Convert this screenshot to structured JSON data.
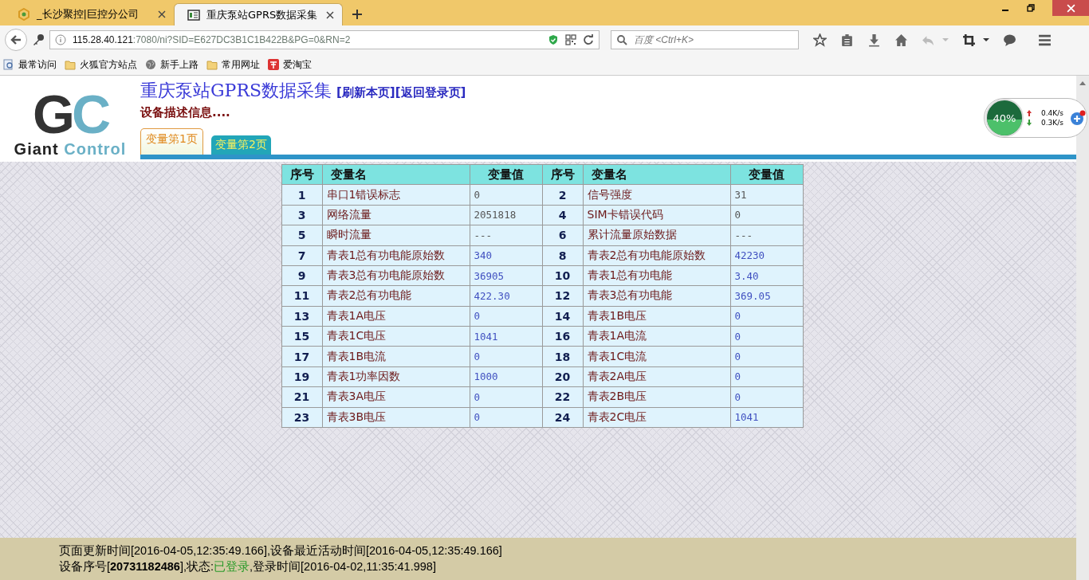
{
  "browser": {
    "tabs": [
      {
        "title": "_长沙聚控|巨控分公司",
        "selected": false
      },
      {
        "title": "重庆泵站GPRS数据采集",
        "selected": true
      }
    ],
    "address": {
      "host": "115.28.40.121",
      "rest": ":7080/ni?SID=E627DC3B1C1B422B&PG=0&RN=2"
    },
    "search": {
      "placeholder": "百度 <Ctrl+K>"
    },
    "bookmarks": [
      {
        "label": "最常访问",
        "kind": "search"
      },
      {
        "label": "火狐官方站点",
        "kind": "folder"
      },
      {
        "label": "新手上路",
        "kind": "globe"
      },
      {
        "label": "常用网址",
        "kind": "folder"
      },
      {
        "label": "爱淘宝",
        "kind": "shop"
      }
    ]
  },
  "logo": {
    "mark_left": "G",
    "mark_right": "C",
    "word1": "Giant",
    "word2": "Control"
  },
  "header": {
    "title": "重庆泵站GPRS数据采集",
    "links": [
      "[刷新本页]",
      "[返回登录页]"
    ],
    "subtitle": "设备描述信息...."
  },
  "page_tabs": [
    {
      "label": "变量第1页",
      "selected": true
    },
    {
      "label": "变量第2页",
      "selected": false
    }
  ],
  "table": {
    "columns": [
      "序号",
      "变量名",
      "变量值",
      "序号",
      "变量名",
      "变量值"
    ],
    "rows": [
      [
        {
          "no": "1",
          "name": "串口1错误标志",
          "value": "0",
          "kind": "raw"
        },
        {
          "no": "2",
          "name": "信号强度",
          "value": "31",
          "kind": "raw"
        }
      ],
      [
        {
          "no": "3",
          "name": "网络流量",
          "value": "2051818",
          "kind": "raw"
        },
        {
          "no": "4",
          "name": "SIM卡错误代码",
          "value": "0",
          "kind": "raw"
        }
      ],
      [
        {
          "no": "5",
          "name": "瞬时流量",
          "value": "---",
          "kind": "raw"
        },
        {
          "no": "6",
          "name": "累计流量原始数据",
          "value": "---",
          "kind": "raw"
        }
      ],
      [
        {
          "no": "7",
          "name": "青表1总有功电能原始数",
          "value": "340",
          "kind": "meter"
        },
        {
          "no": "8",
          "name": "青表2总有功电能原始数",
          "value": "42230",
          "kind": "meter"
        }
      ],
      [
        {
          "no": "9",
          "name": "青表3总有功电能原始数",
          "value": "36905",
          "kind": "meter"
        },
        {
          "no": "10",
          "name": "青表1总有功电能",
          "value": "3.40",
          "kind": "meter"
        }
      ],
      [
        {
          "no": "11",
          "name": "青表2总有功电能",
          "value": "422.30",
          "kind": "meter"
        },
        {
          "no": "12",
          "name": "青表3总有功电能",
          "value": "369.05",
          "kind": "meter"
        }
      ],
      [
        {
          "no": "13",
          "name": "青表1A电压",
          "value": "0",
          "kind": "meter"
        },
        {
          "no": "14",
          "name": "青表1B电压",
          "value": "0",
          "kind": "meter"
        }
      ],
      [
        {
          "no": "15",
          "name": "青表1C电压",
          "value": "1041",
          "kind": "meter"
        },
        {
          "no": "16",
          "name": "青表1A电流",
          "value": "0",
          "kind": "meter"
        }
      ],
      [
        {
          "no": "17",
          "name": "青表1B电流",
          "value": "0",
          "kind": "meter"
        },
        {
          "no": "18",
          "name": "青表1C电流",
          "value": "0",
          "kind": "meter"
        }
      ],
      [
        {
          "no": "19",
          "name": "青表1功率因数",
          "value": "1000",
          "kind": "meter"
        },
        {
          "no": "20",
          "name": "青表2A电压",
          "value": "0",
          "kind": "meter"
        }
      ],
      [
        {
          "no": "21",
          "name": "青表3A电压",
          "value": "0",
          "kind": "meter"
        },
        {
          "no": "22",
          "name": "青表2B电压",
          "value": "0",
          "kind": "meter"
        }
      ],
      [
        {
          "no": "23",
          "name": "青表3B电压",
          "value": "0",
          "kind": "meter"
        },
        {
          "no": "24",
          "name": "青表2C电压",
          "value": "1041",
          "kind": "meter"
        }
      ]
    ]
  },
  "footer": {
    "update_line": "页面更新时间[2016-04-05,12:35:49.166],设备最近活动时间[2016-04-05,12:35:49.166]",
    "device_line": {
      "serial": "设备序号[**20731182486**],状态:",
      "state": "已登录",
      "login": ",登录时间[2016-04-02,11:35:41.998]"
    }
  },
  "net_widget": {
    "percent": "40%",
    "up": "0.4K/s",
    "down": "0.3K/s"
  }
}
